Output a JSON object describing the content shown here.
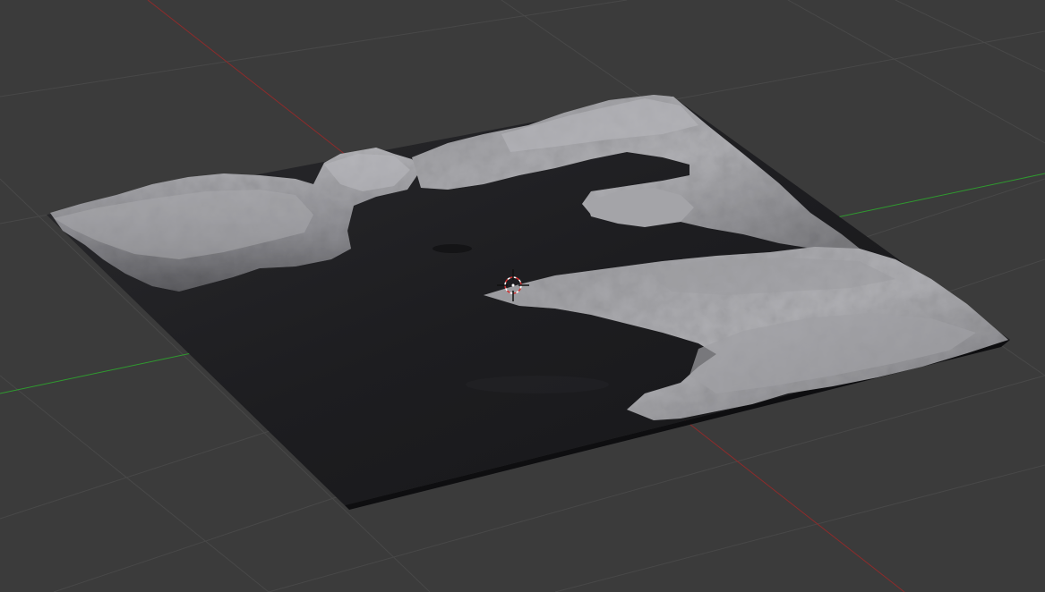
{
  "viewport": {
    "background_color": "#3b3b3b",
    "grid_line_color": "#4a4a4a",
    "x_axis_color": "#9a2a2a",
    "y_axis_color": "#2f9a2f",
    "terrain_dark_color": "#1c1c1e",
    "terrain_light_color": "#a6a6aa",
    "cursor_icon": "3d-cursor-icon"
  }
}
